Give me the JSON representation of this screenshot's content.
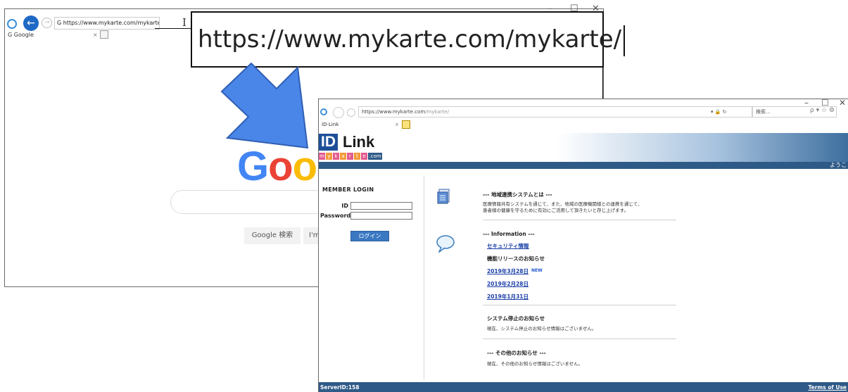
{
  "back_window": {
    "win_min": "–",
    "win_max": "☐",
    "win_close": "✕",
    "back_arrow": "←",
    "forward_arrow": "→",
    "address": "G https://www.mykarte.com/mykarte/",
    "cursor": "I",
    "tab_label": "G Google",
    "tab_close": "×",
    "google_logo": [
      "G",
      "o",
      "o"
    ],
    "google_logo_colors": [
      "#4285f4",
      "#ea4335",
      "#fbbc05"
    ],
    "search_button": "Google 検索",
    "lucky_button": "I'm"
  },
  "zoom_callout": {
    "url": "https://www.mykarte.com/mykarte/"
  },
  "front_window": {
    "win_min": "–",
    "win_max": "☐",
    "win_close": "✕",
    "address_main": "https://www.mykarte.com",
    "address_rest": "/mykarte/",
    "address_controls": "▾ 🔒 ↻",
    "search_placeholder": "検索...",
    "toolbar_right": "ρ ▾  ☆ ⚙",
    "tab_label": "ID-Link",
    "tab_close": "×",
    "logo_id": "ID",
    "logo_link": "Link",
    "logo_sub_letters": [
      "m",
      "y",
      "k",
      "a",
      "r",
      "t",
      "e",
      ".com"
    ],
    "welcome": "ようこ",
    "login": {
      "title": "MEMBER LOGIN",
      "id_label": "ID",
      "password_label": "Password",
      "button": "ログイン"
    },
    "sections": {
      "about_title": "--- 地域連携システムとは ---",
      "about_line1": "医療情報共有システムを通じて、また、地域の医療機関様との連携を通じて、",
      "about_line2": "患者様の健康を守るために有効にご活用して頂きたいと存じ上げます。",
      "info_title": "--- Information ---",
      "security_link": "セキュリティ情報",
      "release_title": "機能リリースのお知らせ",
      "release_links": [
        "2019年3月28日",
        "2019年2月28日",
        "2019年1月31日"
      ],
      "new_badge": "NEW",
      "stop_title": "システム停止のお知らせ",
      "stop_text": "現在、システム停止のお知らせ情報はございません。",
      "other_title": "--- その他のお知らせ ---",
      "other_text": "現在、その他のお知らせ情報はございません。"
    },
    "footer": {
      "server_id": "ServerID:158",
      "terms": "Terms of Use"
    }
  }
}
